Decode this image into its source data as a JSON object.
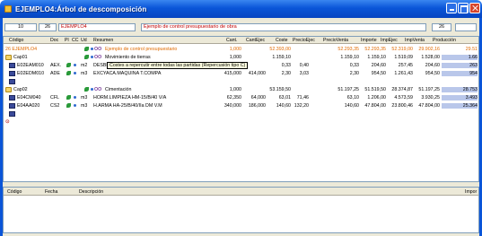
{
  "window": {
    "title": "EJEMPLO4:Árbol de descomposición"
  },
  "toolbar": {
    "level": "10",
    "page": "26",
    "code": "EJEMPLO4",
    "description": "Ejemplo de control presupuestario de obra",
    "right_count": "26"
  },
  "columns": [
    "Código",
    "Doc",
    "Pl",
    "CC",
    "Ud",
    "Resumen",
    "Cant.",
    "CantEjec",
    "Coste",
    "PrecioEjec",
    "PrecioVenta",
    "Importe",
    "ImpEjec",
    "ImpVenta",
    "Producción"
  ],
  "rows": [
    {
      "code": "26 EJEMPLO4",
      "doc": "",
      "ud": "",
      "oo": "OO",
      "desc": "Ejemplo de control presupuestario",
      "cant": "1,000",
      "cantejec": "",
      "coste": "52.393,00",
      "precioejec": "",
      "precioventa": "52.293,35",
      "importe": "52.293,35",
      "impejec": "52.319,00",
      "impventa": "29.902,16",
      "produccion": "52.393,35",
      "extra": "29.51",
      "kind": "root"
    },
    {
      "code": "Cap01",
      "doc": "",
      "ud": "",
      "oo": "OO",
      "desc": "Movimiento de tierras",
      "cant": "1,000",
      "cantejec": "",
      "coste": "1.159,10",
      "precioejec": "",
      "precioventa": "1.159,10",
      "importe": "1.159,10",
      "impejec": "1.519,09",
      "impventa": "1.528,00",
      "produccion": "1.159,10",
      "extra": "1.66",
      "kind": "chapter"
    },
    {
      "code": "E02EAM010",
      "doc": "AEX.",
      "ud": "m2",
      "oo": "",
      "desc": "DESBROCE Y LIMPIEZA",
      "cant": "",
      "cantejec": "",
      "coste": "0,33",
      "precioejec": "0,40",
      "precioventa": "0,33",
      "importe": "204,60",
      "impejec": "257,45",
      "impventa": "204,60",
      "produccion": "",
      "extra": "263",
      "kind": "item"
    },
    {
      "code": "E02EDM010",
      "doc": "ADE",
      "ud": "m3",
      "oo": "",
      "desc": "EXCYACA.MAQUINA T.COMPA",
      "cant": "415,000",
      "cantejec": "414,000",
      "coste": "2,30",
      "precioejec": "3,03",
      "precioventa": "2,30",
      "importe": "954,50",
      "impejec": "1.261,43",
      "impventa": "954,50",
      "produccion": "",
      "extra": "954",
      "kind": "item"
    },
    {
      "code": "Cap02",
      "doc": "",
      "ud": "",
      "oo": "OO",
      "desc": "Cimentación",
      "cant": "1,000",
      "cantejec": "",
      "coste": "53.159,50",
      "precioejec": "",
      "precioventa": "51.197,25",
      "importe": "51.519,50",
      "impejec": "28.374,87",
      "impventa": "51.197,25",
      "produccion": "",
      "extra": "28.753",
      "kind": "chapter"
    },
    {
      "code": "E04CM040",
      "doc": "CFL",
      "ud": "m3",
      "oo": "",
      "desc": "HORM.LIMPIEZA HM-15/B/40 V/A",
      "cant": "62,350",
      "cantejec": "64,000",
      "coste": "63,01",
      "precioejec": "71,46",
      "precioventa": "63,10",
      "importe": "1.206,00",
      "impejec": "4.573,59",
      "impventa": "3.930,25",
      "produccion": "",
      "extra": "3.493",
      "kind": "item"
    },
    {
      "code": "E04AA020",
      "doc": "CS2",
      "ud": "m3",
      "oo": "",
      "desc": "H.ARMA HA-25/B/40/IIa DM V.M",
      "cant": "340,000",
      "cantejec": "186,000",
      "coste": "140,60",
      "precioejec": "132,20",
      "precioventa": "140,60",
      "importe": "47.804,00",
      "impejec": "23.800,46",
      "impventa": "47.804,00",
      "produccion": "",
      "extra": "25.364",
      "kind": "item"
    }
  ],
  "tooltip": "Costes a repercutir entre todas las partidas (Repercusión tipo C)",
  "bottom": {
    "columns": [
      "Código",
      "Fecha",
      "Descripción",
      "Impor"
    ]
  },
  "colors": {
    "title_bar": "#0a55d8",
    "accent_orange": "#e06a00",
    "highlight_blue": "#b9c7ea"
  }
}
